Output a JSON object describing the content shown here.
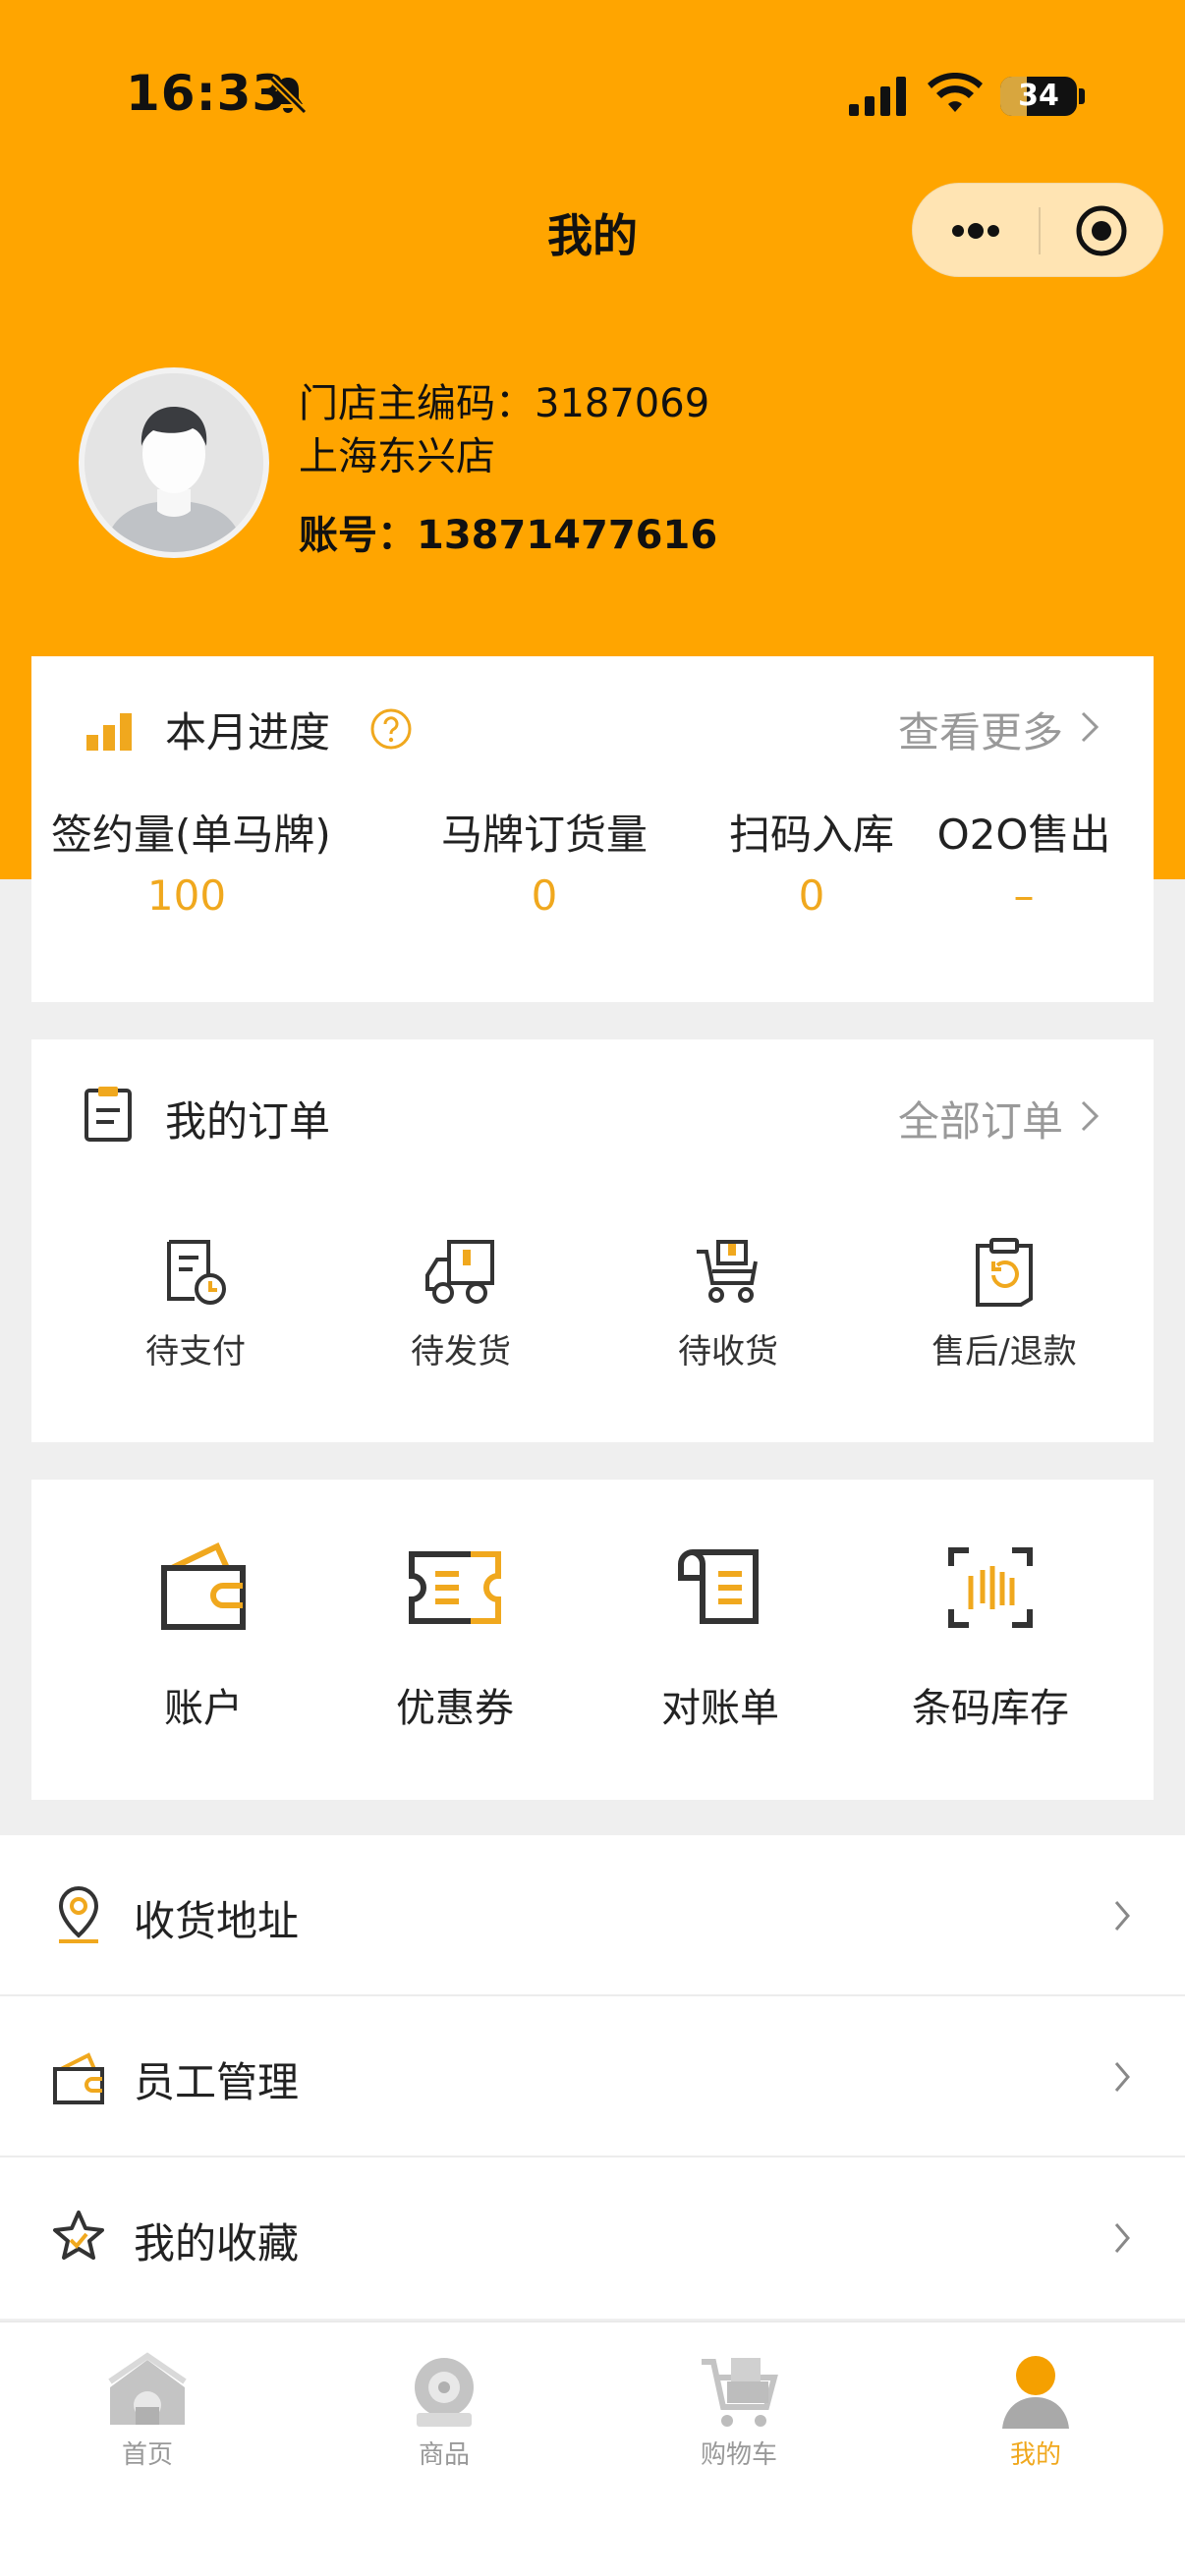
{
  "status_bar": {
    "time": "16:33",
    "battery": "34",
    "battery_percent": 34
  },
  "nav": {
    "title": "我的"
  },
  "profile": {
    "store_code": "门店主编码：3187069",
    "store_name": "上海东兴店",
    "account": "账号：13871477616"
  },
  "progress": {
    "title": "本月进度",
    "more": "查看更多",
    "stats": [
      {
        "label": "签约量(单马牌)",
        "value": "100"
      },
      {
        "label": "马牌订货量",
        "value": "0"
      },
      {
        "label": "扫码入库",
        "value": "0"
      },
      {
        "label": "O2O售出",
        "value": "–"
      }
    ]
  },
  "orders": {
    "title": "我的订单",
    "more": "全部订单",
    "items": [
      {
        "label": "待支付",
        "icon": "pending-payment-icon"
      },
      {
        "label": "待发货",
        "icon": "truck-icon"
      },
      {
        "label": "待收货",
        "icon": "cart-delivery-icon"
      },
      {
        "label": "售后/退款",
        "icon": "refund-clipboard-icon"
      }
    ]
  },
  "tools": {
    "items": [
      {
        "label": "账户",
        "icon": "wallet-icon"
      },
      {
        "label": "优惠券",
        "icon": "coupon-icon"
      },
      {
        "label": "对账单",
        "icon": "statement-icon"
      },
      {
        "label": "条码库存",
        "icon": "barcode-scan-icon"
      }
    ]
  },
  "menu": {
    "items": [
      {
        "label": "收货地址",
        "icon": "location-pin-icon"
      },
      {
        "label": "员工管理",
        "icon": "wallet-icon"
      },
      {
        "label": "我的收藏",
        "icon": "star-icon"
      }
    ]
  },
  "tabbar": {
    "items": [
      {
        "label": "首页",
        "icon": "home-icon"
      },
      {
        "label": "商品",
        "icon": "tire-icon"
      },
      {
        "label": "购物车",
        "icon": "cart-icon"
      },
      {
        "label": "我的",
        "icon": "user-icon",
        "active": true
      }
    ]
  },
  "colors": {
    "brand": "#ffa500",
    "accent": "#f0a81e",
    "background": "#efefef"
  }
}
